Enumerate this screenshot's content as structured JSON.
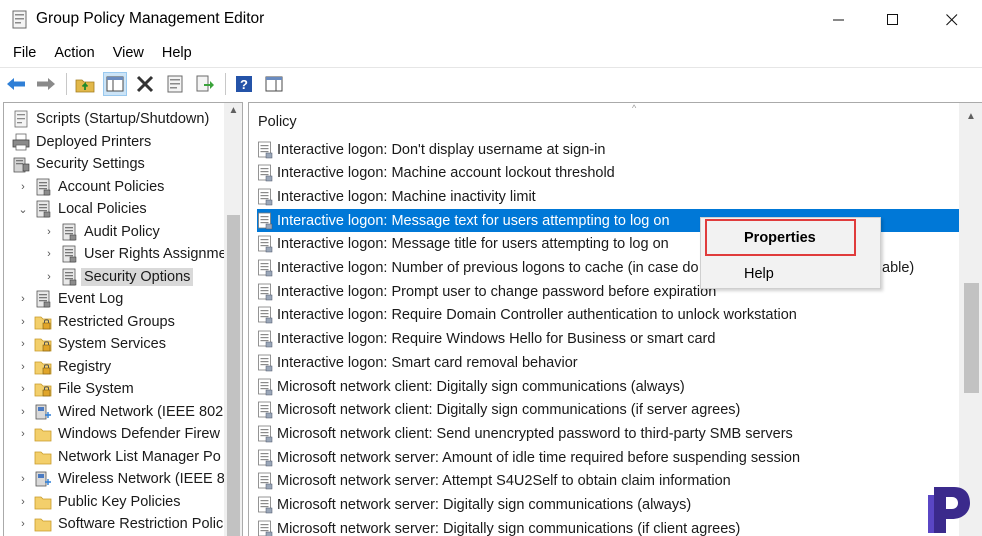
{
  "window": {
    "title": "Group Policy Management Editor",
    "minimize_glyph": "—",
    "maximize_glyph": "☐",
    "close_glyph": "✕"
  },
  "menu": [
    "File",
    "Action",
    "View",
    "Help"
  ],
  "toolbar": {
    "buttons": [
      "back-arrow-icon",
      "forward-arrow-icon",
      "up-folder-icon",
      "show-hide-tree-icon",
      "delete-icon",
      "properties-icon",
      "export-list-icon",
      "help-icon",
      "show-hide-action-pane-icon"
    ]
  },
  "tree": {
    "items": [
      {
        "label": "Scripts (Startup/Shutdown)",
        "icon": "scripts-icon",
        "chevron": ""
      },
      {
        "label": "Deployed Printers",
        "icon": "printer-icon",
        "chevron": ""
      },
      {
        "label": "Security Settings",
        "icon": "security-settings-icon",
        "chevron": ""
      },
      {
        "label": "Account Policies",
        "icon": "policy-icon",
        "chevron": "›"
      },
      {
        "label": "Local Policies",
        "icon": "policy-icon",
        "chevron": "⌄"
      },
      {
        "label": "Audit Policy",
        "icon": "policy-icon",
        "chevron": "›"
      },
      {
        "label": "User Rights Assignme",
        "icon": "policy-icon",
        "chevron": "›"
      },
      {
        "label": "Security Options",
        "icon": "policy-icon",
        "chevron": "›"
      },
      {
        "label": "Event Log",
        "icon": "policy-icon",
        "chevron": "›"
      },
      {
        "label": "Restricted Groups",
        "icon": "folder-lock-icon",
        "chevron": "›"
      },
      {
        "label": "System Services",
        "icon": "folder-lock-icon",
        "chevron": "›"
      },
      {
        "label": "Registry",
        "icon": "folder-lock-icon",
        "chevron": "›"
      },
      {
        "label": "File System",
        "icon": "folder-lock-icon",
        "chevron": "›"
      },
      {
        "label": "Wired Network (IEEE 802",
        "icon": "network-icon",
        "chevron": "›"
      },
      {
        "label": "Windows Defender Firew",
        "icon": "folder-icon",
        "chevron": "›"
      },
      {
        "label": "Network List Manager Po",
        "icon": "folder-icon",
        "chevron": ""
      },
      {
        "label": "Wireless Network (IEEE 8",
        "icon": "network-icon",
        "chevron": "›"
      },
      {
        "label": "Public Key Policies",
        "icon": "folder-icon",
        "chevron": "›"
      },
      {
        "label": "Software Restriction Polic",
        "icon": "folder-icon",
        "chevron": "›"
      }
    ]
  },
  "list": {
    "column_header": "Policy",
    "sort_indicator": "^",
    "rows": [
      "Interactive logon: Don't display username at sign-in",
      "Interactive logon: Machine account lockout threshold",
      "Interactive logon: Machine inactivity limit",
      "Interactive logon: Message text for users attempting to log on",
      "Interactive logon: Message title for users attempting to log on",
      "Interactive logon: Number of previous logons to cache (in case do",
      "Interactive logon: Prompt user to change password before expiration",
      "Interactive logon: Require Domain Controller authentication to unlock workstation",
      "Interactive logon: Require Windows Hello for Business or smart card",
      "Interactive logon: Smart card removal behavior",
      "Microsoft network client: Digitally sign communications (always)",
      "Microsoft network client: Digitally sign communications (if server agrees)",
      "Microsoft network client: Send unencrypted password to third-party SMB servers",
      "Microsoft network server: Amount of idle time required before suspending session",
      "Microsoft network server: Attempt S4U2Self to obtain claim information",
      "Microsoft network server: Digitally sign communications (always)",
      "Microsoft network server: Digitally sign communications (if client agrees)"
    ],
    "row5_overflow_text": "able)"
  },
  "context_menu": {
    "items": [
      "Properties",
      "Help"
    ]
  },
  "colors": {
    "selection": "#0078d7",
    "highlight_box": "#e03c3c",
    "logo": "#3b2a8c"
  }
}
